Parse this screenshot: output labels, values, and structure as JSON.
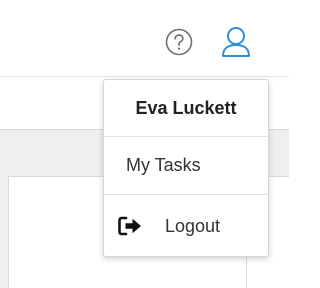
{
  "header": {
    "help_icon": "question-circle-icon",
    "user_icon": "user-outline-icon",
    "accent_color": "#2f8fd8"
  },
  "user_menu": {
    "user_name": "Eva Luckett",
    "items": [
      {
        "label": "My Tasks"
      },
      {
        "label": "Logout",
        "icon": "sign-out-icon"
      }
    ]
  }
}
